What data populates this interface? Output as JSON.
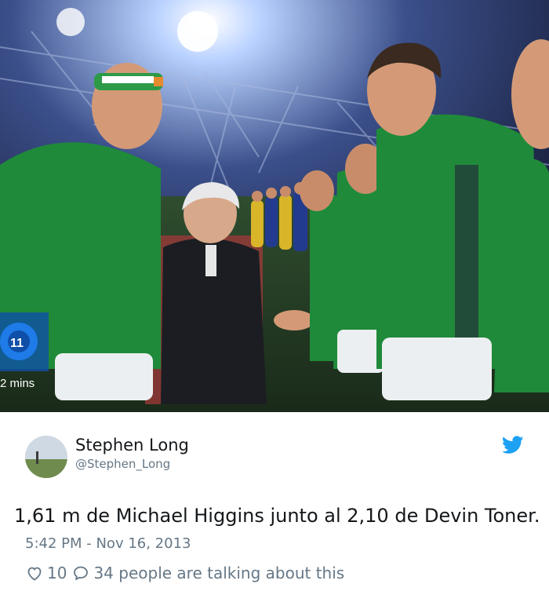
{
  "photo": {
    "broadcast_badge": "11",
    "broadcast_timer": "2 mins"
  },
  "tweet": {
    "author_name": "Stephen Long",
    "author_handle": "@Stephen_Long",
    "text": "1,61 m de Michael Higgins junto al 2,10 de Devin Toner.",
    "timestamp": "5:42 PM - Nov 16, 2013",
    "likes": "10",
    "talking": "34 people are talking about this",
    "twitter_blue": "#1da1f2"
  },
  "icons": {
    "like": "heart-icon",
    "reply": "speech-bubble-icon",
    "brand": "twitter-bird-icon"
  }
}
